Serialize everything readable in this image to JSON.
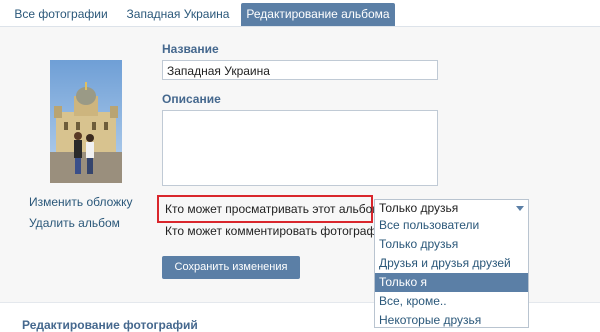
{
  "tabs": [
    {
      "label": "Все фотографии"
    },
    {
      "label": "Западная Украина"
    },
    {
      "label": "Редактирование альбома"
    }
  ],
  "sidebar": {
    "change_cover": "Изменить обложку",
    "delete_album": "Удалить альбом"
  },
  "form": {
    "title_label": "Название",
    "title_value": "Западная Украина",
    "description_label": "Описание",
    "description_value": "",
    "view_privacy_label": "Кто может просматривать этот альбом?",
    "comment_privacy_label": "Кто может комментировать фотографии",
    "view_privacy_selected": "Только друзья",
    "save_label": "Сохранить изменения"
  },
  "dropdown": {
    "options": [
      {
        "label": "Все пользователи"
      },
      {
        "label": "Только друзья"
      },
      {
        "label": "Друзья и друзья друзей"
      },
      {
        "label": "Только я"
      },
      {
        "label": "Все, кроме.."
      },
      {
        "label": "Некоторые друзья"
      }
    ],
    "highlighted": "Только я"
  },
  "footer": {
    "section_title": "Редактирование фотографий"
  },
  "colors": {
    "accent": "#5b7fa6",
    "link": "#2b587a",
    "highlight_border": "#d9262c"
  }
}
